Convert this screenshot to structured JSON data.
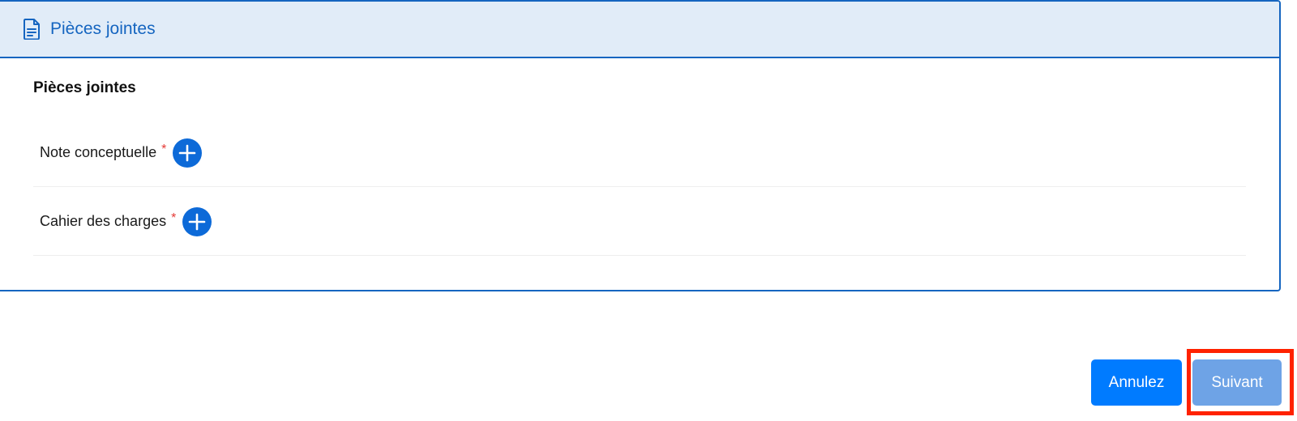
{
  "header": {
    "icon": "document-icon",
    "title": "Pièces jointes"
  },
  "section": {
    "title": "Pièces jointes"
  },
  "attachments": [
    {
      "label": "Note conceptuelle",
      "required_mark": "*",
      "icon": "plus-circle-icon"
    },
    {
      "label": "Cahier des charges",
      "required_mark": "*",
      "icon": "plus-circle-icon"
    }
  ],
  "footer": {
    "cancel_label": "Annulez",
    "next_label": "Suivant"
  },
  "colors": {
    "primary": "#1565c0",
    "header_bg": "#e1ecf8",
    "button_primary": "#007bff",
    "button_disabled": "#6ea3e6",
    "required": "#e53935",
    "highlight": "#ff2200"
  }
}
